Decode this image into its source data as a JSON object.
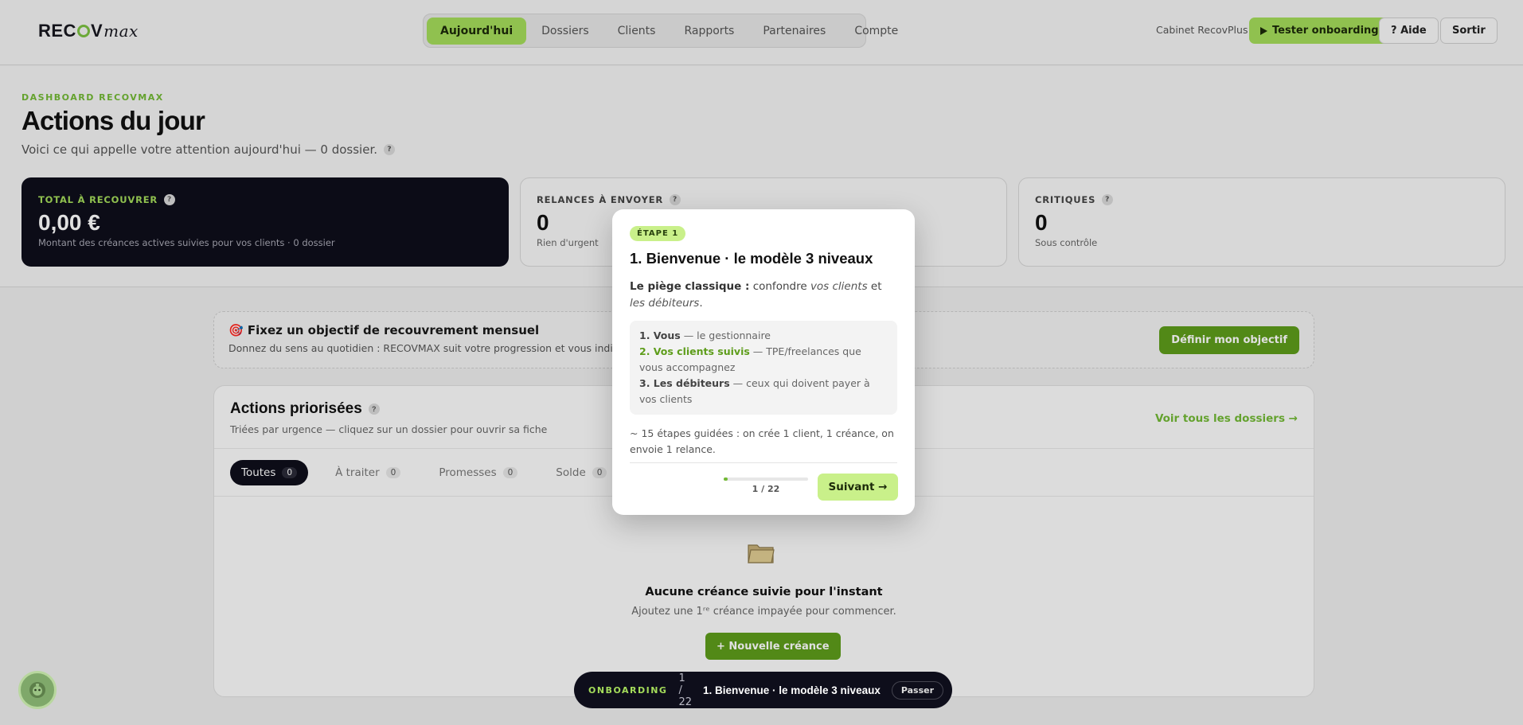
{
  "header": {
    "logo": {
      "prefix": "REC",
      "mid": "V",
      "script": "max"
    },
    "nav": [
      {
        "label": "Aujourd'hui",
        "active": true
      },
      {
        "label": "Dossiers"
      },
      {
        "label": "Clients"
      },
      {
        "label": "Rapports"
      },
      {
        "label": "Partenaires"
      },
      {
        "label": "Compte"
      }
    ],
    "cabinet": "Cabinet RecovPlus",
    "test_button": "Tester onboarding",
    "help_button": "? Aide",
    "logout_button": "Sortir"
  },
  "top": {
    "kicker": "DASHBOARD RECOVMAX",
    "title": "Actions du jour",
    "subtitle": "Voici ce qui appelle votre attention aujourd'hui — 0 dossier.",
    "stats": [
      {
        "label": "TOTAL À RECOUVRER",
        "value": "0,00 €",
        "sub": "Montant des créances actives suivies pour vos clients · 0 dossier"
      },
      {
        "label": "RELANCES À ENVOYER",
        "value": "0",
        "sub": "Rien d'urgent"
      },
      {
        "label": "CRITIQUES",
        "value": "0",
        "sub": "Sous contrôle"
      }
    ]
  },
  "goal": {
    "title": "🎯 Fixez un objectif de recouvrement mensuel",
    "desc": "Donnez du sens au quotidien : RECOVMAX suit votre progression et vous indique le r",
    "button": "Définir mon objectif"
  },
  "actions": {
    "title": "Actions priorisées",
    "sub": "Triées par urgence — cliquez sur un dossier pour ouvrir sa fiche",
    "link": "Voir tous les dossiers →",
    "tabs": [
      {
        "label": "Toutes",
        "count": "0",
        "active": true
      },
      {
        "label": "À traiter",
        "count": "0"
      },
      {
        "label": "Promesses",
        "count": "0"
      },
      {
        "label": "Solde",
        "count": "0"
      },
      {
        "label": "⚠"
      }
    ],
    "empty_title": "Aucune créance suivie pour l'instant",
    "empty_sub": "Ajoutez une 1ʳᵉ créance impayée pour commencer.",
    "new_button": "+ Nouvelle créance"
  },
  "modal": {
    "badge": "ÉTAPE 1",
    "title": "1. Bienvenue · le modèle 3 niveaux",
    "intro_bold": "Le piège classique :",
    "intro_1": " confondre ",
    "intro_em1": "vos clients",
    "intro_2": " et ",
    "intro_em2": "les débiteurs",
    "intro_3": ".",
    "levels": [
      {
        "num": "1. Vous",
        "desc": " — le gestionnaire"
      },
      {
        "num": "2. Vos clients suivis",
        "desc": " — TPE/freelances que vous accompagnez"
      },
      {
        "num": "3. Les débiteurs",
        "desc": " — ceux qui doivent payer à vos clients"
      }
    ],
    "note": "~ 15 étapes guidées : on crée 1 client, 1 créance, on envoie 1 relance.",
    "progress": {
      "current": 1,
      "total": 22,
      "text": "1 / 22"
    },
    "next_button": "Suivant →"
  },
  "onboarding_bar": {
    "label": "ONBOARDING",
    "count": "1 / 22",
    "title": "1. Bienvenue · le modèle 3 niveaux",
    "skip": "Passer"
  },
  "colors": {
    "accent": "#a4dc5a",
    "accent_dark": "#5e9d1b",
    "dark": "#0e0e1b"
  },
  "icons": [
    "play-icon",
    "help-icon",
    "folder-icon",
    "target-icon",
    "warning-icon",
    "chatbot-icon"
  ]
}
